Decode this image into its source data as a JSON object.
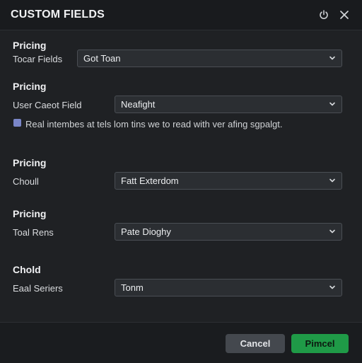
{
  "header": {
    "title": "CUSTOM FIELDS",
    "icons": {
      "power": "power-icon",
      "close": "close-icon"
    }
  },
  "sections": [
    {
      "title": "Pricing",
      "label": "Tocar Fields",
      "value": "Got Toan"
    },
    {
      "title": "Pricing",
      "label": "User Caeot Field",
      "value": "Neafight"
    },
    {
      "title": "Pricing",
      "label": "Choull",
      "value": "Fatt Exterdom"
    },
    {
      "title": "Pricing",
      "label": "Toal Rens",
      "value": "Pate Dioghy"
    },
    {
      "title": "Chold",
      "label": "Eaal Seriers",
      "value": "Tonm"
    }
  ],
  "checkbox": {
    "text": "Real intembes at tels lom tins we to read with ver afing sgpalgt."
  },
  "footer": {
    "cancel_label": "Cancel",
    "primary_label": "Pimcel"
  },
  "colors": {
    "background": "#1f2124",
    "field": "#2b2e32",
    "primary": "#1f9a47",
    "checkbox": "#7a86c8"
  }
}
